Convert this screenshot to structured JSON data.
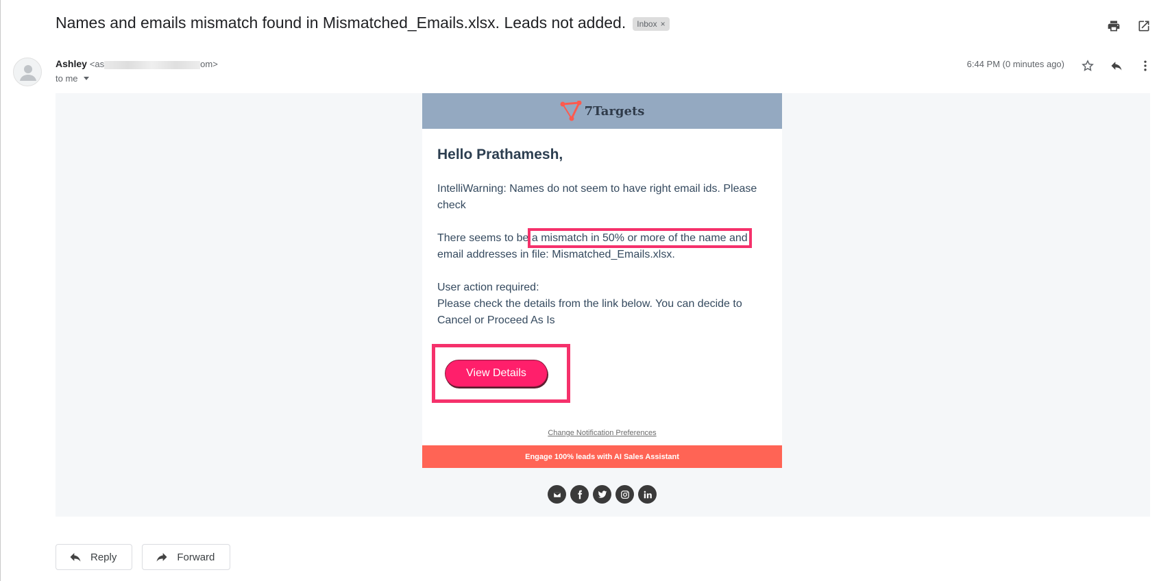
{
  "email": {
    "subject": "Names and emails mismatch found in Mismatched_Emails.xlsx. Leads not added.",
    "label": "Inbox",
    "label_remove": "×",
    "sender_name": "Ashley",
    "sender_email_start": "<as",
    "sender_email_end": "om>",
    "recipient": "to me",
    "time": "6:44 PM (0 minutes ago)"
  },
  "message": {
    "brand": "7Targets",
    "greeting": "Hello Prathamesh,",
    "warning": "IntelliWarning: Names do not seem to have right email ids. Please check",
    "mismatch_before": "There seems to be",
    "mismatch_highlight": "a mismatch in 50% or more of the name and",
    "mismatch_after": "email addresses in file: Mismatched_Emails.xlsx.",
    "action_required": "User action required:",
    "action_text": "Please check the details from the link below. You can decide to Cancel or Proceed As Is",
    "button_label": "View Details",
    "preferences_link": "Change Notification Preferences",
    "promo": "Engage 100% leads with AI Sales Assistant",
    "social_icons": [
      "mail-icon",
      "facebook-icon",
      "twitter-icon",
      "instagram-icon",
      "linkedin-icon"
    ]
  },
  "actions": {
    "reply": "Reply",
    "forward": "Forward"
  },
  "colors": {
    "highlight": "#f5316b",
    "button": "#ff1f6b",
    "header": "#94a9c1",
    "promo": "#ff6455"
  }
}
